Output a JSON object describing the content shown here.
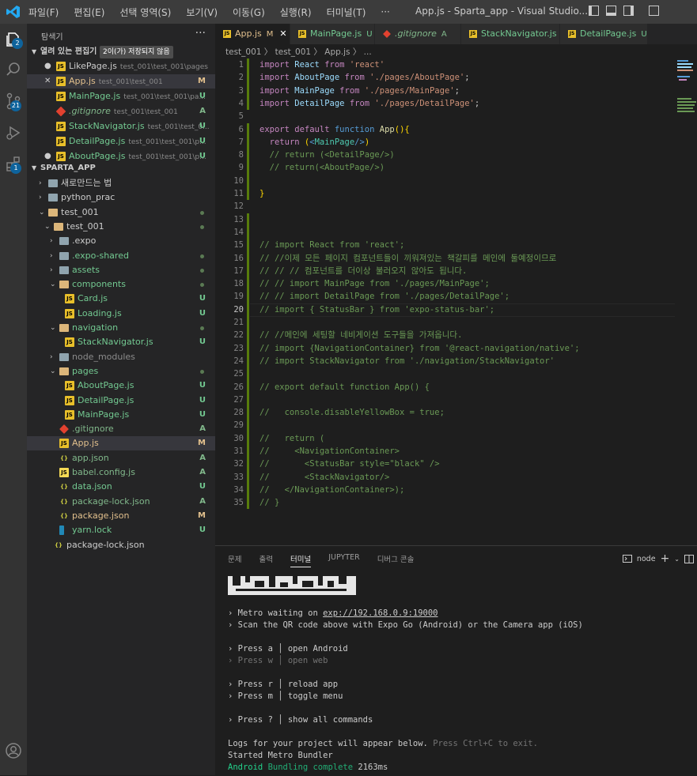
{
  "menu": [
    "파일(F)",
    "편집(E)",
    "선택 영역(S)",
    "보기(V)",
    "이동(G)",
    "실행(R)",
    "터미널(T)",
    "···"
  ],
  "window_title": "App.js - Sparta_app - Visual Studio...",
  "activity_badges": {
    "scm": "21",
    "extensions": "1",
    "explorer": "2"
  },
  "sidebar": {
    "title": "탐색기",
    "open_editors": {
      "label": "열려 있는 편집기",
      "badge": "2이(가) 저장되지 않음",
      "items": [
        {
          "lead": "●",
          "name": "LikePage.js",
          "path": "test_001\\test_001\\pages",
          "status": ""
        },
        {
          "lead": "✕",
          "name": "App.js",
          "path": "test_001\\test_001",
          "status": "M"
        },
        {
          "lead": "",
          "name": "MainPage.js",
          "path": "test_001\\test_001\\pa...",
          "status": "U"
        },
        {
          "lead": "",
          "name": ".gitignore",
          "path": "test_001\\test_001",
          "status": "A"
        },
        {
          "lead": "",
          "name": "StackNavigator.js",
          "path": "test_001\\test_0...",
          "status": "U"
        },
        {
          "lead": "",
          "name": "DetailPage.js",
          "path": "test_001\\test_001\\p...",
          "status": "U"
        },
        {
          "lead": "●",
          "name": "AboutPage.js",
          "path": "test_001\\test_001\\p...",
          "status": "U"
        }
      ]
    },
    "project": {
      "label": "SPARTA_APP",
      "tree": [
        {
          "name": "새로만드는 법",
          "chev": "›",
          "status": ""
        },
        {
          "name": "python_prac",
          "chev": "›",
          "status": ""
        },
        {
          "name": "test_001",
          "chev": "⌄",
          "status": "●"
        },
        {
          "name": "test_001",
          "chev": "⌄",
          "status": "●"
        },
        {
          "name": ".expo",
          "chev": "›",
          "status": ""
        },
        {
          "name": ".expo-shared",
          "chev": "›",
          "status": "●"
        },
        {
          "name": "assets",
          "chev": "›",
          "status": "●"
        },
        {
          "name": "components",
          "chev": "⌄",
          "status": "●"
        },
        {
          "name": "Card.js",
          "chev": "",
          "status": "U"
        },
        {
          "name": "Loading.js",
          "chev": "",
          "status": "U"
        },
        {
          "name": "navigation",
          "chev": "⌄",
          "status": "●"
        },
        {
          "name": "StackNavigator.js",
          "chev": "",
          "status": "U"
        },
        {
          "name": "node_modules",
          "chev": "›",
          "status": ""
        },
        {
          "name": "pages",
          "chev": "⌄",
          "status": "●"
        },
        {
          "name": "AboutPage.js",
          "chev": "",
          "status": "U"
        },
        {
          "name": "DetailPage.js",
          "chev": "",
          "status": "U"
        },
        {
          "name": "MainPage.js",
          "chev": "",
          "status": "U"
        },
        {
          "name": ".gitignore",
          "chev": "",
          "status": "A"
        },
        {
          "name": "App.js",
          "chev": "",
          "status": "M"
        },
        {
          "name": "app.json",
          "chev": "",
          "status": "A"
        },
        {
          "name": "babel.config.js",
          "chev": "",
          "status": "A"
        },
        {
          "name": "data.json",
          "chev": "",
          "status": "U"
        },
        {
          "name": "package-lock.json",
          "chev": "",
          "status": "A"
        },
        {
          "name": "package.json",
          "chev": "",
          "status": "M"
        },
        {
          "name": "yarn.lock",
          "chev": "",
          "status": "U"
        },
        {
          "name": "package-lock.json",
          "chev": "",
          "status": ""
        }
      ]
    }
  },
  "tabs": [
    {
      "name": "App.js",
      "status": "M",
      "close": "✕"
    },
    {
      "name": "MainPage.js",
      "status": "U",
      "close": ""
    },
    {
      "name": ".gitignore",
      "status": "A",
      "close": ""
    },
    {
      "name": "StackNavigator.js",
      "status": "U",
      "close": ""
    },
    {
      "name": "DetailPage.js",
      "status": "U",
      "close": ""
    }
  ],
  "breadcrumb": "test_001 〉 test_001 〉 App.js 〉 ...",
  "code_lines": [
    "import React from 'react'",
    "import AboutPage from './pages/AboutPage';",
    "import MainPage from './pages/MainPage';",
    "import DetailPage from './pages/DetailPage';",
    "",
    "export default function App(){",
    "  return (<MainPage/>)",
    "  // return (<DetailPage/>)",
    "  // return(<AboutPage/>)",
    "",
    "}",
    "",
    "",
    "",
    "// import React from 'react';",
    "// //이제 모든 페이지 컴포넌트들이 끼워져있는 책갈피를 메인에 둘예정이므로",
    "// // // 컴포넌트를 더이상 불러오지 않아도 됩니다.",
    "// // import MainPage from './pages/MainPage';",
    "// // import DetailPage from './pages/DetailPage';",
    "// import { StatusBar } from 'expo-status-bar';",
    "",
    "// //메인에 세팅할 네비게이션 도구들을 가져옵니다.",
    "// import {NavigationContainer} from '@react-navigation/native';",
    "// import StackNavigator from './navigation/StackNavigator'",
    "",
    "// export default function App() {",
    "",
    "//   console.disableYellowBox = true;",
    "",
    "//   return (",
    "//     <NavigationContainer>",
    "//       <StatusBar style=\"black\" />",
    "//       <StackNavigator/>",
    "//   </NavigationContainer>);",
    "// }"
  ],
  "current_line": 20,
  "panel": {
    "tabs": [
      "문제",
      "출력",
      "터미널",
      "JUPYTER",
      "디버그 콘솔"
    ],
    "active_tab": "터미널",
    "terminal_name": "node",
    "lines": [
      {
        "a": "› Metro waiting on ",
        "b": "exp://192.168.0.9:19000",
        "c": ""
      },
      {
        "a": "› Scan the QR code above with Expo Go (Android) or the Camera app (iOS)",
        "b": "",
        "c": ""
      },
      {
        "a": "› Press a │ open Android",
        "b": "",
        "c": ""
      },
      {
        "a": "› Press w │ open web",
        "b": "",
        "c": ""
      },
      {
        "a": "› Press r │ reload app",
        "b": "",
        "c": ""
      },
      {
        "a": "› Press m │ toggle menu",
        "b": "",
        "c": ""
      },
      {
        "a": "› Press ? │ show all commands",
        "b": "",
        "c": ""
      },
      {
        "a": "Logs for your project will appear below. ",
        "b": "Press Ctrl+C to exit.",
        "c": ""
      },
      {
        "a": "Started Metro Bundler",
        "b": "",
        "c": ""
      },
      {
        "a": "Android",
        "b": " Bundling complete ",
        "c": "2163ms"
      }
    ]
  }
}
